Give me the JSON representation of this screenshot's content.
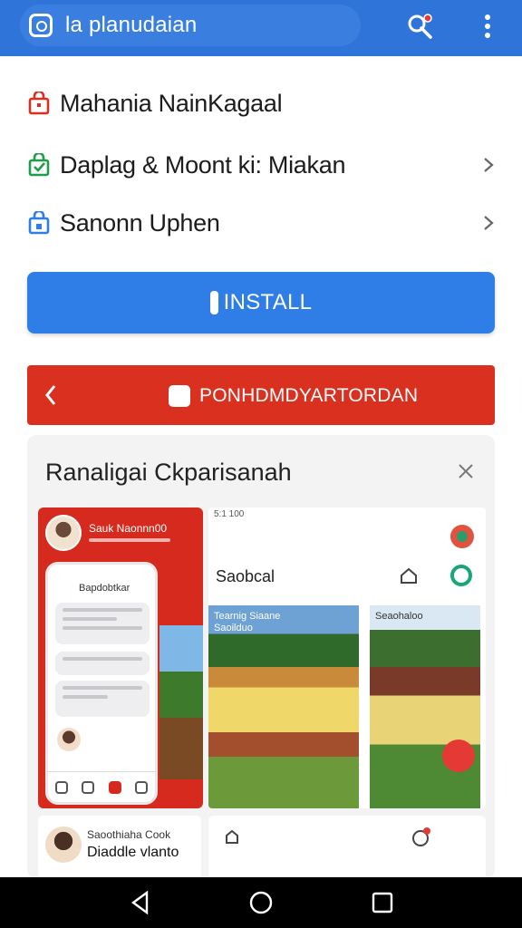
{
  "browser": {
    "url_text": "la planudaian",
    "icons": [
      "lock-icon",
      "key-icon",
      "more-vert-icon"
    ]
  },
  "rows": [
    {
      "label": "Mahania NainKagaal",
      "icon": "bag-icon",
      "icon_color": "#d9301f"
    },
    {
      "label": "Daplag & Moont ki: Miakan",
      "icon": "bag-check-icon",
      "icon_color": "#1e9e4a"
    },
    {
      "label": "Sanonn Uphen",
      "icon": "bag-share-icon",
      "icon_color": "#2f7de6"
    }
  ],
  "install": {
    "label": "INSTALL"
  },
  "redbar": {
    "title": "PONHDMDYARTORDAN"
  },
  "card": {
    "title": "Ranaligai Ckparisanah",
    "shot_left": {
      "header": "Sauk Naonnn00",
      "phone_title": "Bapdobtkar"
    },
    "chip_left": {
      "line1": "Saoothiaha Cook",
      "line2": "Diaddle vlanto"
    },
    "shot_right": {
      "status": "5:1 100",
      "title": "Saobcal",
      "caption1": "Tearnig Siaane\nSaoilduo",
      "caption2": "Seaohaloo"
    }
  },
  "colors": {
    "topbar": "#2f74d8",
    "install": "#2f7de6",
    "redbar": "#d9301f"
  }
}
